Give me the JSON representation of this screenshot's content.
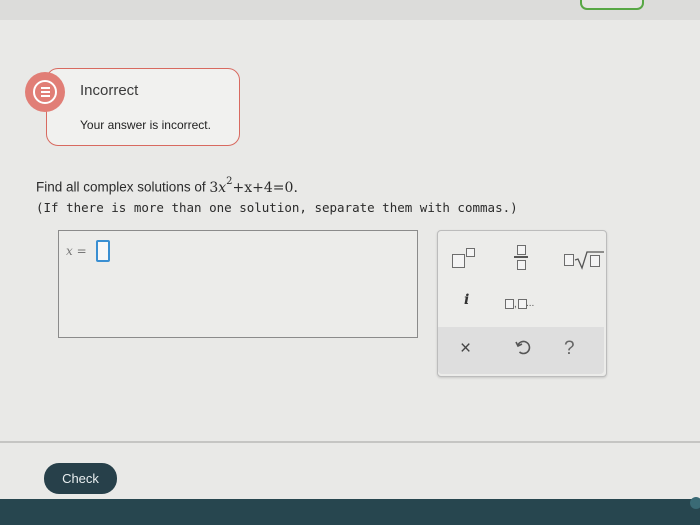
{
  "feedback": {
    "title": "Incorrect",
    "message": "Your answer is incorrect."
  },
  "question": {
    "prefix": "Find all complex solutions of ",
    "eq_a": "3",
    "eq_var": "x",
    "eq_exp": "2",
    "eq_rest": "+x+4=0.",
    "hint": "(If there is more than one solution, separate them with commas.)"
  },
  "answer": {
    "label": "x =",
    "value": ""
  },
  "keypad": {
    "imaginary_label": "i",
    "list_sep": ",",
    "list_dots": "...",
    "clear_symbol": "×",
    "help_symbol": "?"
  },
  "footer": {
    "check_label": "Check"
  },
  "colors": {
    "error": "#e17e76",
    "accent_blue": "#3a8fd2",
    "button_bg": "#27404a",
    "bottom_bar": "#27464f"
  },
  "icons": [
    "error-feedback-icon",
    "superscript-icon",
    "fraction-icon",
    "radical-icon",
    "clear-icon",
    "undo-icon",
    "help-icon"
  ]
}
